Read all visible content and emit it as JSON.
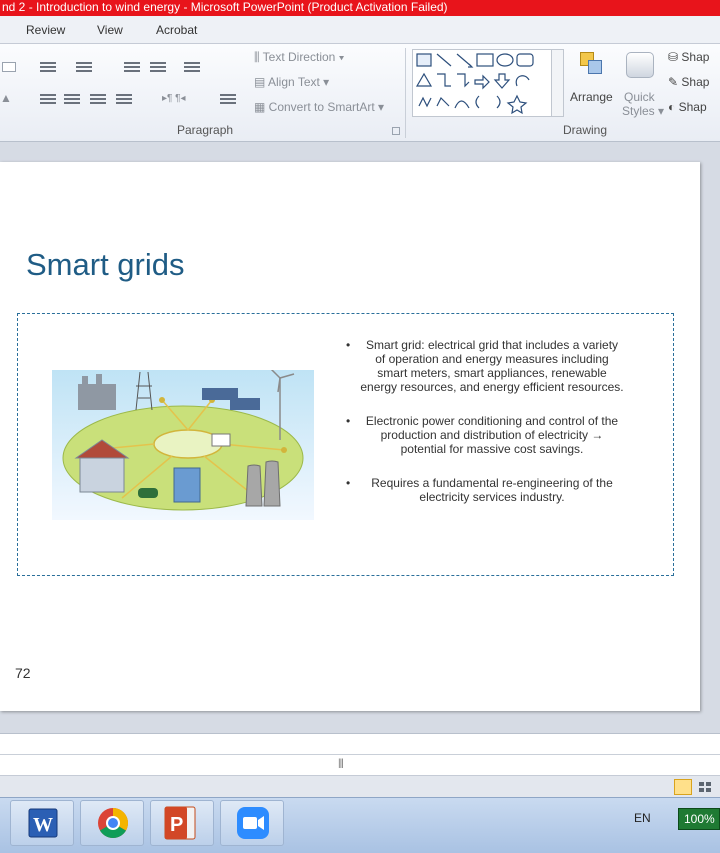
{
  "window": {
    "title": "nd 2 - Introduction to wind energy  -  Microsoft PowerPoint (Product Activation Failed)"
  },
  "menu": {
    "tabs": [
      "Review",
      "View",
      "Acrobat"
    ]
  },
  "ribbon": {
    "text_direction_label": "Text Direction",
    "align_text_label": "Align Text",
    "convert_smartart_label": "Convert to SmartArt",
    "arrange_label": "Arrange",
    "quick_styles_line1": "Quick",
    "quick_styles_line2": "Styles",
    "shape_fill_label": "Shap",
    "shape_outline_label": "Shap",
    "shape_effects_label": "Shap",
    "paragraph_group_label": "Paragraph",
    "drawing_group_label": "Drawing"
  },
  "slide": {
    "title": "Smart grids",
    "bullets": [
      "Smart grid: electrical grid that includes a variety of operation and energy measures including smart meters, smart appliances, renewable energy resources, and energy efficient resources.",
      "Electronic power conditioning and control of the production and distribution of electricity → potential for massive cost savings.",
      "Requires a fundamental re-engineering of the electricity services industry."
    ],
    "page_number": "72"
  },
  "statusbar": {
    "splitter_grip": "|||"
  },
  "taskbar": {
    "language": "EN",
    "zoom": "100%"
  },
  "colors": {
    "titlebar": "#e8141b",
    "slide_title": "#1f5c85",
    "dashed_border": "#2a6f9a"
  },
  "icons": [
    "word-icon",
    "chrome-icon",
    "powerpoint-icon",
    "zoom-icon"
  ]
}
